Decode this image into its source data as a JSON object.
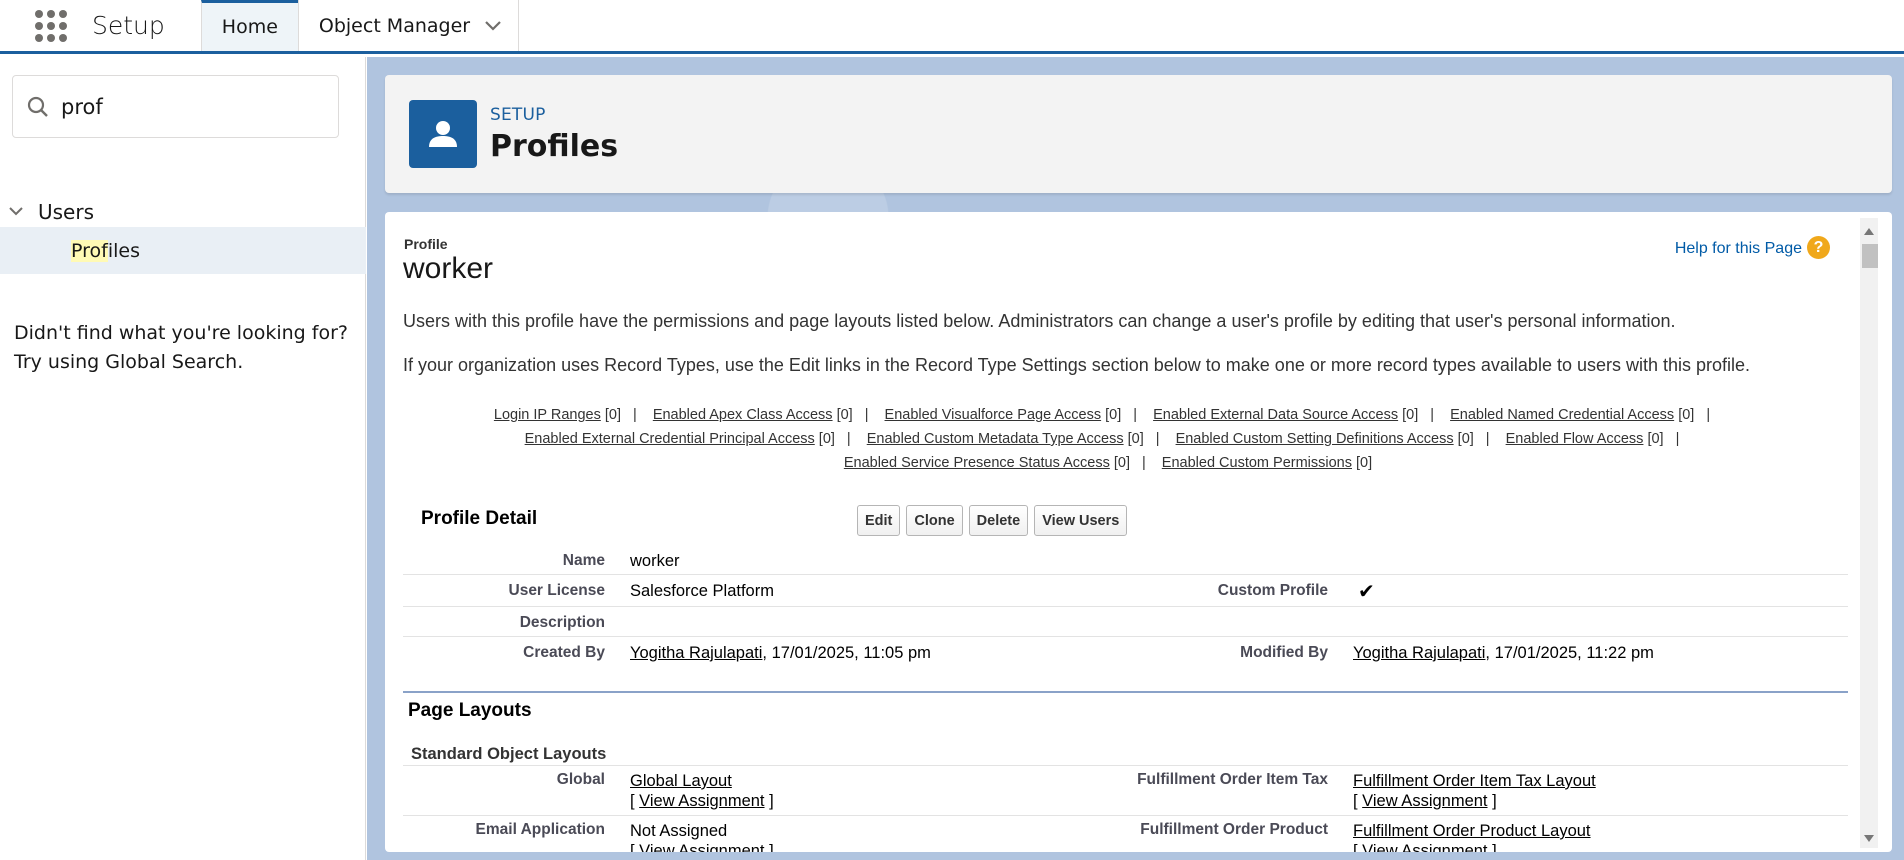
{
  "nav": {
    "app_name": "Setup",
    "tabs": [
      {
        "label": "Home"
      },
      {
        "label": "Object Manager"
      }
    ]
  },
  "sidebar": {
    "search_value": "prof",
    "tree": {
      "parent_label": "Users",
      "child_highlight": "Prof",
      "child_rest": "iles"
    },
    "not_found_line1": "Didn't find what you're looking for?",
    "not_found_line2": "Try using Global Search."
  },
  "header": {
    "eyebrow": "SETUP",
    "title": "Profiles",
    "icon": "user-icon"
  },
  "profile": {
    "label": "Profile",
    "name": "worker",
    "help_link": "Help for this Page",
    "description1": "Users with this profile have the permissions and page layouts listed below. Administrators can change a user's profile by editing that user's personal information.",
    "description2": "If your organization uses Record Types, use the Edit links in the Record Type Settings section below to make one or more record types available to users with this profile."
  },
  "related_links": [
    {
      "label": "Login IP Ranges",
      "count": "[0]"
    },
    {
      "label": "Enabled Apex Class Access",
      "count": "[0]"
    },
    {
      "label": "Enabled Visualforce Page Access",
      "count": "[0]"
    },
    {
      "label": "Enabled External Data Source Access",
      "count": "[0]"
    },
    {
      "label": "Enabled Named Credential Access",
      "count": "[0]"
    },
    {
      "label": "Enabled External Credential Principal Access",
      "count": "[0]"
    },
    {
      "label": "Enabled Custom Metadata Type Access",
      "count": "[0]"
    },
    {
      "label": "Enabled Custom Setting Definitions Access",
      "count": "[0]"
    },
    {
      "label": "Enabled Flow Access",
      "count": "[0]"
    },
    {
      "label": "Enabled Service Presence Status Access",
      "count": "[0]"
    },
    {
      "label": "Enabled Custom Permissions",
      "count": "[0]"
    }
  ],
  "detail": {
    "title": "Profile Detail",
    "buttons": {
      "edit": "Edit",
      "clone": "Clone",
      "delete": "Delete",
      "view_users": "View Users"
    },
    "name_label": "Name",
    "name_value": "worker",
    "user_license_label": "User License",
    "user_license_value": "Salesforce Platform",
    "custom_profile_label": "Custom Profile",
    "custom_profile_checked": true,
    "custom_profile_mark": "✔",
    "description_label": "Description",
    "created_by_label": "Created By",
    "created_by_user": "Yogitha Rajulapati",
    "created_by_date": ", 17/01/2025, 11:05 pm",
    "modified_by_label": "Modified By",
    "modified_by_user": "Yogitha Rajulapati",
    "modified_by_date": ", 17/01/2025, 11:22 pm"
  },
  "page_layouts": {
    "title": "Page Layouts",
    "subtitle": "Standard Object Layouts",
    "rows": [
      {
        "left_label": "Global",
        "left_value": "Global Layout",
        "left_assign_open": "[ ",
        "left_assign": "View Assignment",
        "left_assign_close": " ]",
        "right_label": "Fulfillment Order Item Tax",
        "right_value": "Fulfillment Order Item Tax Layout",
        "right_assign_open": "[ ",
        "right_assign": "View Assignment",
        "right_assign_close": " ]"
      },
      {
        "left_label": "Email Application",
        "left_value": "Not Assigned",
        "left_assign_open": "[ ",
        "left_assign": "View Assignment",
        "left_assign_close": " ]",
        "right_label": "Fulfillment Order Product",
        "right_value": "Fulfillment Order Product Layout",
        "right_assign_open": "[ ",
        "right_assign": "View Assignment",
        "right_assign_close": " ]"
      }
    ]
  },
  "colors": {
    "brand": "#1b5f9e",
    "link": "#015ba7",
    "help_icon": "#f0a81b",
    "search_highlight": "#fffab5"
  }
}
